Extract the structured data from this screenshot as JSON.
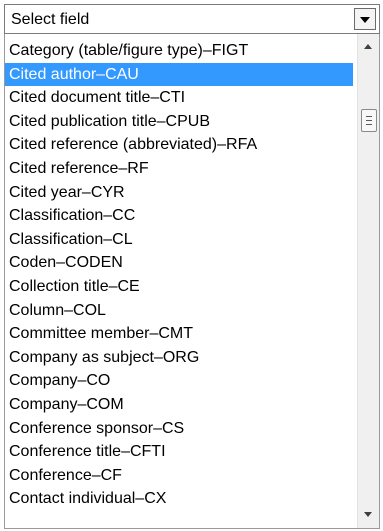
{
  "select": {
    "value": "Select field"
  },
  "dropdown": {
    "options": [
      "Category (table/figure type)–FIGT",
      "Cited author–CAU",
      "Cited document title–CTI",
      "Cited publication title–CPUB",
      "Cited reference (abbreviated)–RFA",
      "Cited reference–RF",
      "Cited year–CYR",
      "Classification–CC",
      "Classification–CL",
      "Coden–CODEN",
      "Collection title–CE",
      "Column–COL",
      "Committee member–CMT",
      "Company as subject–ORG",
      "Company–CO",
      "Company–COM",
      "Conference sponsor–CS",
      "Conference title–CFTI",
      "Conference–CF",
      "Contact individual–CX"
    ],
    "selected_index": 1
  },
  "colors": {
    "highlight": "#3399ff",
    "highlight_text": "#ffffff"
  },
  "icons": {
    "select_arrow": "chevron-down-icon",
    "scroll_up": "arrow-up-icon",
    "scroll_down": "arrow-down-icon",
    "scroll_thumb_grip": "grip-icon"
  }
}
